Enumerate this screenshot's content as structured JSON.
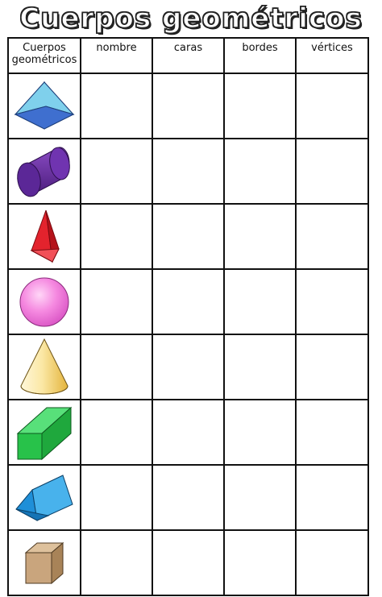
{
  "title": "Cuerpos geométricos",
  "headers": {
    "col1_line1": "Cuerpos",
    "col1_line2": "geométricos",
    "col2": "nombre",
    "col3": "caras",
    "col4": "bordes",
    "col5": "vértices"
  },
  "shapes": [
    {
      "icon": "square-pyramid-icon",
      "color": "#4a7fd6"
    },
    {
      "icon": "cylinder-icon",
      "color": "#6a2ba0"
    },
    {
      "icon": "triangular-pyramid-icon",
      "color": "#e0242c"
    },
    {
      "icon": "sphere-icon",
      "color": "#f07fd8"
    },
    {
      "icon": "cone-icon",
      "color": "#f2d36a"
    },
    {
      "icon": "rectangular-prism-icon",
      "color": "#2ecc52"
    },
    {
      "icon": "triangular-prism-icon",
      "color": "#2a9ee0"
    },
    {
      "icon": "cube-icon",
      "color": "#c9a57d"
    }
  ]
}
